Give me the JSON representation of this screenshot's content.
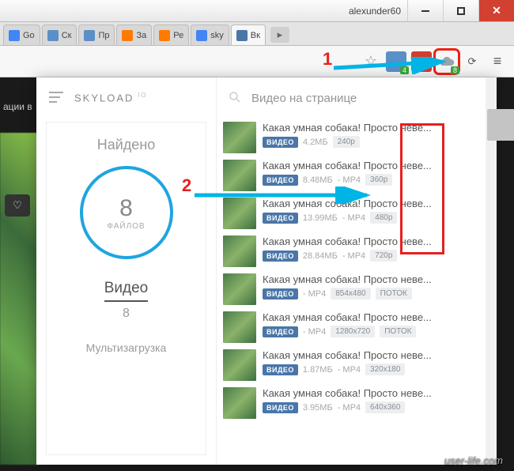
{
  "window": {
    "username": "alexunder60",
    "close": "✕"
  },
  "tabs": [
    {
      "label": "Go",
      "color": "#4285f4"
    },
    {
      "label": "Ск",
      "color": "#5b8fc7"
    },
    {
      "label": "Пр",
      "color": "#5b8fc7"
    },
    {
      "label": "За",
      "color": "#ff7b00"
    },
    {
      "label": "Ре",
      "color": "#ff7b00"
    },
    {
      "label": "sky",
      "color": "#4285f4"
    },
    {
      "label": "Вк",
      "color": "#4a76a8",
      "active": true
    }
  ],
  "toolbar": {
    "abp": "ABP",
    "ext1_badge": "4",
    "skyload_badge": "8"
  },
  "page": {
    "truncated_text": "ации в",
    "heart": "♡"
  },
  "popup": {
    "brand": "SKYLOAD",
    "brand_sup": "˙IO",
    "found_label": "Найдено",
    "count": "8",
    "count_label": "ФАЙЛОВ",
    "category_title": "Видео",
    "category_count": "8",
    "multi": "Мультизагрузка",
    "search_title": "Видео на странице",
    "vk_badge": "ВИДЕО",
    "items": [
      {
        "title": "Какая умная собака! Просто неве...",
        "size": "4.2МБ",
        "fmt": "",
        "res": "240p"
      },
      {
        "title": "Какая умная собака! Просто неве...",
        "size": "8.48МБ",
        "fmt": "MP4",
        "res": "360p"
      },
      {
        "title": "Какая умная собака! Просто неве...",
        "size": "13.99МБ",
        "fmt": "MP4",
        "res": "480p"
      },
      {
        "title": "Какая умная собака! Просто неве...",
        "size": "28.84МБ",
        "fmt": "MP4",
        "res": "720p"
      },
      {
        "title": "Какая умная собака! Просто неве...",
        "size": "",
        "fmt": "MP4",
        "res": "854x480",
        "extra": "ПОТОК"
      },
      {
        "title": "Какая умная собака! Просто неве...",
        "size": "",
        "fmt": "MP4",
        "res": "1280x720",
        "extra": "ПОТОК"
      },
      {
        "title": "Какая умная собака! Просто неве...",
        "size": "1.87МБ",
        "fmt": "MP4",
        "res": "320x180"
      },
      {
        "title": "Какая умная собака! Просто неве...",
        "size": "3.95МБ",
        "fmt": "MP4",
        "res": "640x360"
      }
    ]
  },
  "annotations": {
    "one": "1",
    "two": "2"
  },
  "watermark": "user-life.com"
}
